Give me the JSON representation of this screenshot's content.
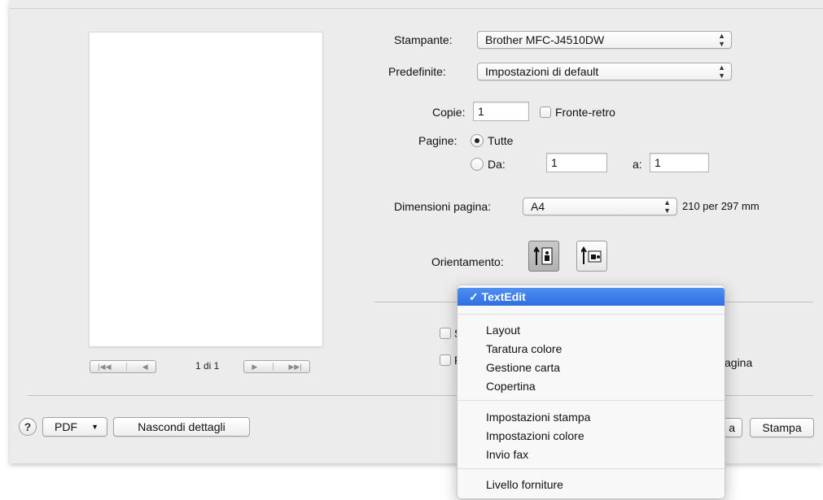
{
  "printer": {
    "label": "Stampante:",
    "value": "Brother MFC-J4510DW"
  },
  "presets": {
    "label": "Predefinite:",
    "value": "Impostazioni di default"
  },
  "copies": {
    "label": "Copie:",
    "value": "1",
    "duplex_label": "Fronte-retro"
  },
  "pages": {
    "label": "Pagine:",
    "all_label": "Tutte",
    "from_label": "Da:",
    "from_value": "1",
    "to_label": "a:",
    "to_value": "1"
  },
  "paper_size": {
    "label": "Dimensioni pagina:",
    "value": "A4",
    "dimensions": "210 per 297 mm"
  },
  "orientation": {
    "label": "Orientamento:",
    "selected": "portrait"
  },
  "preview": {
    "page_counter": "1 di 1"
  },
  "partial_labels": {
    "row1_prefix": "S",
    "row2_prefix": "F",
    "row2_suffix": "agina"
  },
  "menu": {
    "selected": "TextEdit",
    "checkmark": "✓",
    "group1": [
      "Layout",
      "Taratura colore",
      "Gestione carta",
      "Copertina"
    ],
    "group2": [
      "Impostazioni stampa",
      "Impostazioni colore",
      "Invio fax"
    ],
    "group3": [
      "Livello forniture"
    ]
  },
  "footer": {
    "help_label": "?",
    "pdf_label": "PDF",
    "pdf_arrow": "▼",
    "hide_details_label": "Nascondi dettagli",
    "cancel_partial_label": "a",
    "print_label": "Stampa"
  },
  "icons": {
    "first_page": "first-page-icon",
    "prev_page": "previous-page-icon",
    "next_page": "next-page-icon",
    "last_page": "last-page-icon",
    "portrait": "portrait-orientation-icon",
    "landscape": "landscape-orientation-icon"
  },
  "colors": {
    "menu_highlight": "#3478e5",
    "dialog_bg": "#ececec"
  }
}
